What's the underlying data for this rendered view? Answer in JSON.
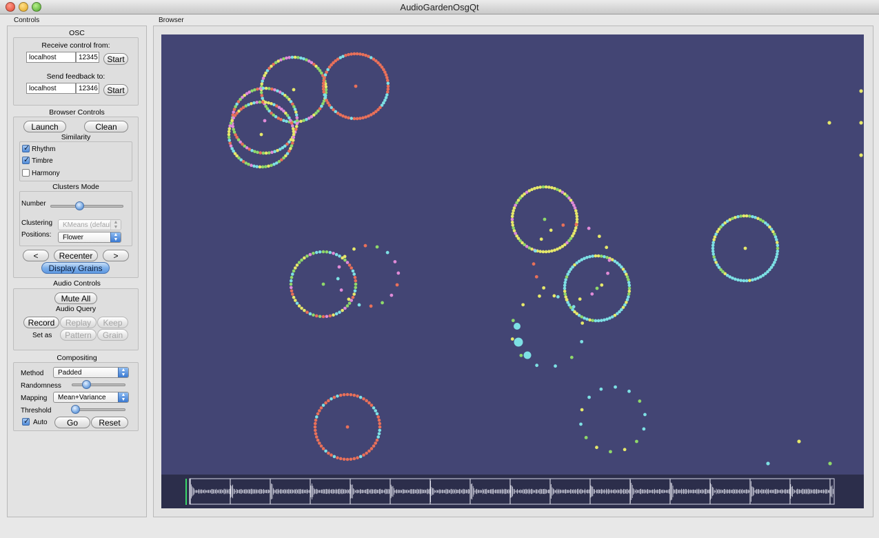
{
  "window": {
    "title": "AudioGardenOsgQt"
  },
  "controls": {
    "label": "Controls",
    "osc": {
      "title": "OSC",
      "receive_label": "Receive control from:",
      "receive_host": "localhost",
      "receive_port": "12345",
      "send_label": "Send feedback to:",
      "send_host": "localhost",
      "send_port": "12346",
      "start_label": "Start"
    },
    "browser_controls": {
      "title": "Browser Controls",
      "launch": "Launch",
      "clean": "Clean",
      "similarity_title": "Similarity",
      "rhythm": "Rhythm",
      "timbre": "Timbre",
      "harmony": "Harmony",
      "rhythm_checked": true,
      "timbre_checked": true,
      "harmony_checked": false,
      "clusters_title": "Clusters Mode",
      "number_label": "Number",
      "number_fraction": 0.45,
      "clustering_label": "Clustering",
      "clustering_value": "KMeans (default)",
      "positions_label": "Positions:",
      "positions_value": "Flower",
      "prev": "<",
      "recenter": "Recenter",
      "next": ">",
      "display_grains": "Display Grains"
    },
    "audio_controls": {
      "title": "Audio Controls",
      "mute_all": "Mute All",
      "query_title": "Audio Query",
      "record": "Record",
      "replay": "Replay",
      "keep": "Keep",
      "set_as": "Set as",
      "pattern": "Pattern",
      "grain": "Grain"
    },
    "compositing": {
      "title": "Compositing",
      "method_label": "Method",
      "method_value": "Padded",
      "randomness_label": "Randomness",
      "randomness_fraction": 0.12,
      "mapping_label": "Mapping",
      "mapping_value": "Mean+Variance",
      "threshold_label": "Threshold",
      "threshold_fraction": 0.08,
      "auto_label": "Auto",
      "auto_checked": true,
      "go": "Go",
      "reset": "Reset"
    }
  },
  "browser": {
    "label": "Browser",
    "colors": {
      "background": "#434574",
      "waveform": "#2c2e4b",
      "cyan": "#7de0e4",
      "yellow": "#e6e86a",
      "green": "#8fd86a",
      "pink": "#e08ad8",
      "orange": "#e8705a",
      "cursor": "#3ad86a"
    }
  }
}
